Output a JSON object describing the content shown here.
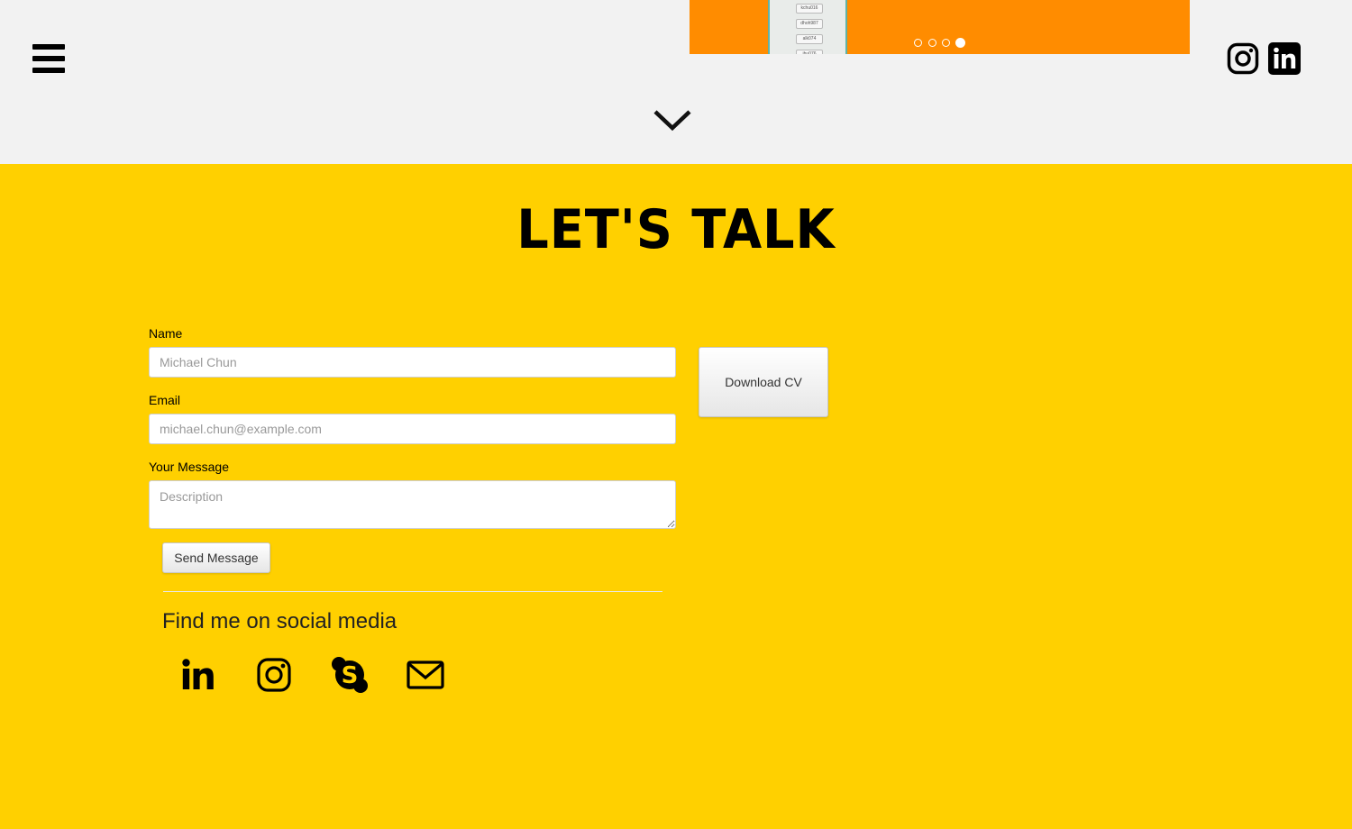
{
  "header": {
    "slider_chips": [
      "kchu016",
      "dhoh987",
      "alk074",
      "jhu076"
    ],
    "slider_dots": 4,
    "active_dot_index": 3,
    "colors": {
      "slider_bg": "#ff8c00"
    },
    "icons": [
      "menu-icon",
      "instagram-icon",
      "linkedin-icon",
      "chevron-down-icon"
    ]
  },
  "contact": {
    "title": "LET'S TALK",
    "background": "#ffd000",
    "name_label": "Name",
    "name_placeholder": "Michael Chun",
    "email_label": "Email",
    "email_placeholder": "michael.chun@example.com",
    "message_label": "Your Message",
    "message_placeholder": "Description",
    "send_label": "Send Message",
    "cv_label": "Download CV",
    "social_heading": "Find me on social media",
    "social_icons": [
      "linkedin-icon",
      "instagram-icon",
      "skype-icon",
      "mail-icon"
    ]
  }
}
